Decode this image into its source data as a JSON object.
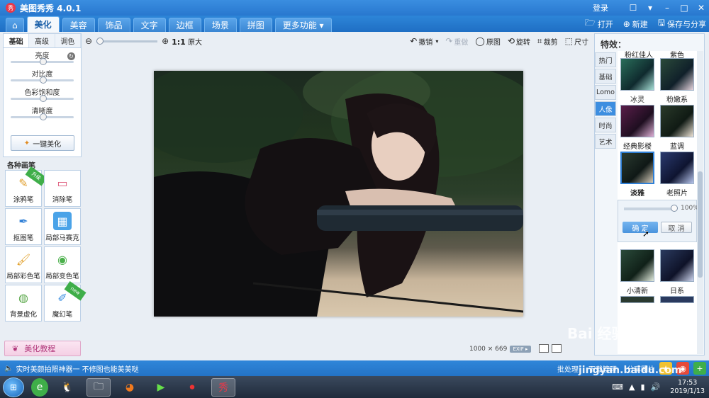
{
  "app": {
    "title": "美图秀秀 4.0.1",
    "logo_text": "秀",
    "login": "登录"
  },
  "window": {
    "controls": [
      "☐",
      "▾",
      "–",
      "□",
      "✕"
    ]
  },
  "menu": {
    "home_icon": "home-icon",
    "tabs": [
      "美化",
      "美容",
      "饰品",
      "文字",
      "边框",
      "场景",
      "拼图",
      "更多功能 ▾"
    ],
    "right": [
      {
        "label": "打开",
        "icon": "folder-icon"
      },
      {
        "label": "新建",
        "icon": "plus-icon"
      },
      {
        "label": "保存与分享",
        "icon": "save-icon"
      }
    ]
  },
  "left": {
    "subtabs": [
      "基础",
      "高级",
      "调色"
    ],
    "sliders": [
      {
        "label": "亮度",
        "level": 0.5
      },
      {
        "label": "对比度",
        "level": 0.5
      },
      {
        "label": "色彩饱和度",
        "level": 0.5
      },
      {
        "label": "清晰度",
        "level": 0.5
      }
    ],
    "onekey_label": "一键美化",
    "brush_title": "各种画笔",
    "brushes": [
      {
        "label": "涂鸦笔",
        "badge": "升级"
      },
      {
        "label": "消除笔",
        "badge": ""
      },
      {
        "label": "抠图笔",
        "badge": ""
      },
      {
        "label": "局部马赛克",
        "badge": ""
      },
      {
        "label": "局部彩色笔",
        "badge": ""
      },
      {
        "label": "局部变色笔",
        "badge": ""
      },
      {
        "label": "背景虚化",
        "badge": ""
      },
      {
        "label": "魔幻笔",
        "badge": "new"
      }
    ],
    "tutorial_label": "美化教程"
  },
  "toolbar": {
    "zoom_ratio": "1:1",
    "zoom_label": "原大",
    "tools": [
      {
        "label": "撤销",
        "icon": "undo-icon",
        "enabled": true
      },
      {
        "label": "重做",
        "icon": "redo-icon",
        "enabled": false
      },
      {
        "label": "原图",
        "icon": "circle-icon",
        "enabled": true
      },
      {
        "label": "旋转",
        "icon": "rotate-icon",
        "enabled": true
      },
      {
        "label": "裁剪",
        "icon": "crop-icon",
        "enabled": true
      },
      {
        "label": "尺寸",
        "icon": "resize-icon",
        "enabled": true
      }
    ]
  },
  "image_info": {
    "size": "1000 × 669",
    "exif": "EXIF ▸"
  },
  "effects": {
    "title": "特效：",
    "categories": [
      "热门",
      "基础",
      "Lomo",
      "人像",
      "时尚",
      "艺术"
    ],
    "active_category": "人像",
    "top_labels": [
      "粉红佳人",
      "紫色"
    ],
    "items": [
      {
        "label": "冰灵"
      },
      {
        "label": "粉嫩系"
      },
      {
        "label": "经典影楼"
      },
      {
        "label": "蓝调"
      },
      {
        "label": "淡雅",
        "selected": true
      },
      {
        "label": "老照片"
      },
      {
        "label": "小清新"
      },
      {
        "label": "日系"
      }
    ],
    "confirm": {
      "percent": "100%",
      "ok": "确 定",
      "cancel": "取 消"
    }
  },
  "status": {
    "message": "实时美颜拍照神器一 不修图也能美美哒",
    "right": [
      "批处理",
      "下载管理",
      "分享图片"
    ]
  },
  "taskbar": {
    "time": "17:53",
    "date": "2019/1/13"
  },
  "watermark": {
    "line1": "Bai 经验",
    "line2": "jingyan.baidu.com"
  }
}
